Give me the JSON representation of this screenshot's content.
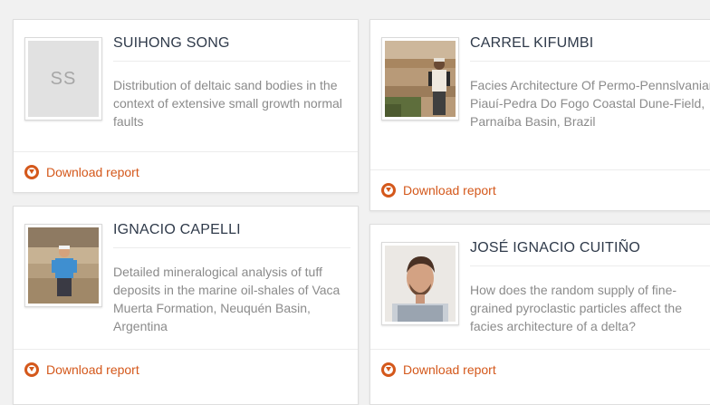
{
  "cards": [
    {
      "name": "SUIHONG SONG",
      "initials": "SS",
      "description": "Distribution of deltaic sand bodies in the context of extensive small growth normal faults",
      "download_label": "Download report"
    },
    {
      "name": "CARREL KIFUMBI",
      "description": "Facies Architecture Of Permo-Pennslvanian Piauí-Pedra Do Fogo Coastal Dune-Field, Parnaíba Basin, Brazil",
      "download_label": "Download report"
    },
    {
      "name": "IGNACIO CAPELLI",
      "description": "Detailed mineralogical analysis of tuff deposits in the marine oil-shales of Vaca Muerta Formation, Neuquén Basin, Argentina",
      "download_label": "Download report"
    },
    {
      "name": "JOSÉ IGNACIO CUITIÑO",
      "description": "How does the random supply of fine-grained pyroclastic particles affect the facies architecture of a delta?",
      "download_label": "Download report"
    }
  ],
  "colors": {
    "accent": "#d4581b",
    "name_text": "#2f3a4a",
    "description_text": "#8b8b8b"
  },
  "icons": {
    "download": "download-circle-icon"
  }
}
